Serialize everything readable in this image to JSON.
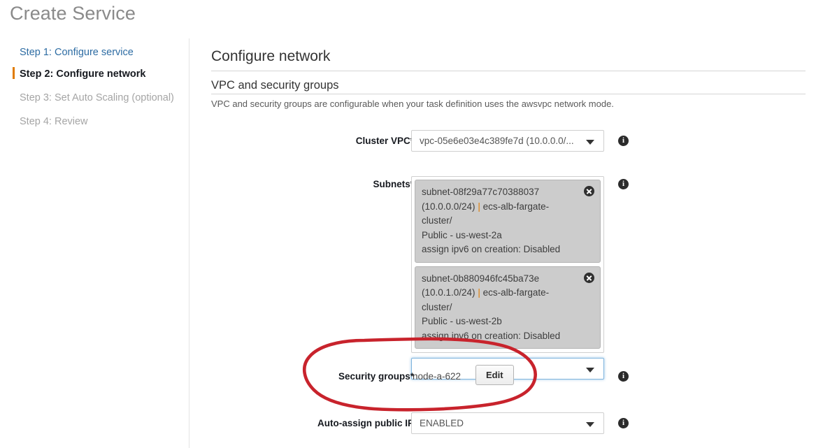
{
  "page": {
    "title": "Create Service"
  },
  "sidebar": {
    "steps": [
      {
        "label": "Step 1: Configure service",
        "state": "link"
      },
      {
        "label": "Step 2: Configure network",
        "state": "current"
      },
      {
        "label": "Step 3: Set Auto Scaling (optional)",
        "state": "disabled"
      },
      {
        "label": "Step 4: Review",
        "state": "disabled"
      }
    ]
  },
  "main": {
    "section_title": "Configure network",
    "subsection_title": "VPC and security groups",
    "subsection_desc": "VPC and security groups are configurable when your task definition uses the awsvpc network mode.",
    "fields": {
      "cluster_vpc": {
        "label": "Cluster VPC",
        "required_mark": "*",
        "value": "vpc-05e6e03e4c389fe7d (10.0.0.0/...",
        "info": "i"
      },
      "subnets": {
        "label": "Subnets",
        "required_mark": "*",
        "info": "i",
        "tokens": [
          {
            "id": "subnet-08f29a77c70388037",
            "cidr": "(10.0.0.0/24)",
            "separator": "|",
            "cluster": "ecs-alb-fargate-cluster/",
            "zone": "Public - us-west-2a",
            "ipv6": "assign ipv6 on creation: Disabled",
            "remove": "close-icon"
          },
          {
            "id": "subnet-0b880946fc45ba73e",
            "cidr": "(10.0.1.0/24)",
            "separator": "|",
            "cluster": "ecs-alb-fargate-cluster/",
            "zone": "Public - us-west-2b",
            "ipv6": "assign ipv6 on creation: Disabled",
            "remove": "close-icon"
          }
        ],
        "add_placeholder": ""
      },
      "security_groups": {
        "label": "Security groups",
        "required_mark": "*",
        "value": "node-a-622",
        "edit_button": "Edit",
        "info": "i"
      },
      "auto_assign_public_ip": {
        "label": "Auto-assign public IP",
        "required_mark": "",
        "value": "ENABLED",
        "info": "i"
      }
    }
  },
  "annotation": {
    "type": "hand-drawn-ellipse",
    "color": "#c8232c",
    "target": "security-groups-row"
  }
}
